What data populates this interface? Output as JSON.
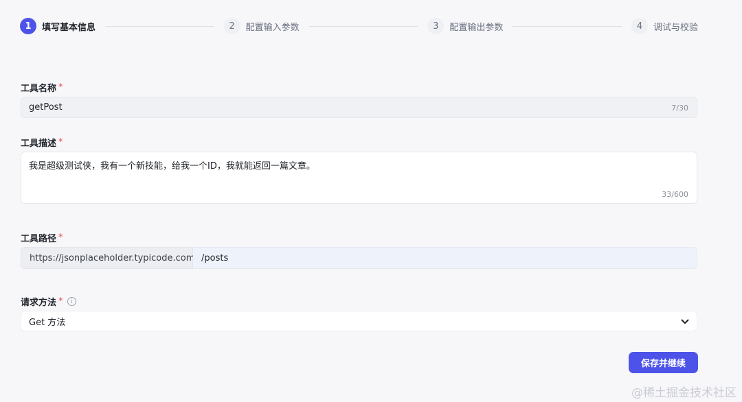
{
  "steps": [
    {
      "num": "1",
      "label": "填写基本信息"
    },
    {
      "num": "2",
      "label": "配置输入参数"
    },
    {
      "num": "3",
      "label": "配置输出参数"
    },
    {
      "num": "4",
      "label": "调试与校验"
    }
  ],
  "form": {
    "required_mark": "*",
    "name": {
      "label": "工具名称",
      "value": "getPost",
      "counter": "7/30"
    },
    "description": {
      "label": "工具描述",
      "value": "我是超级测试侠，我有一个新技能，给我一个ID，我就能返回一篇文章。",
      "counter": "33/600"
    },
    "path": {
      "label": "工具路径",
      "prefix": "https://jsonplaceholder.typicode.com",
      "value": "/posts"
    },
    "method": {
      "label": "请求方法",
      "info_icon": "i",
      "value": "Get 方法"
    }
  },
  "actions": {
    "save_label": "保存并继续"
  },
  "watermark": "@稀土掘金技术社区",
  "colors": {
    "accent": "#4d53e8",
    "required": "#e5484d"
  },
  "icons": {
    "method_info": "info-icon",
    "method_dropdown": "chevron-down-icon"
  }
}
